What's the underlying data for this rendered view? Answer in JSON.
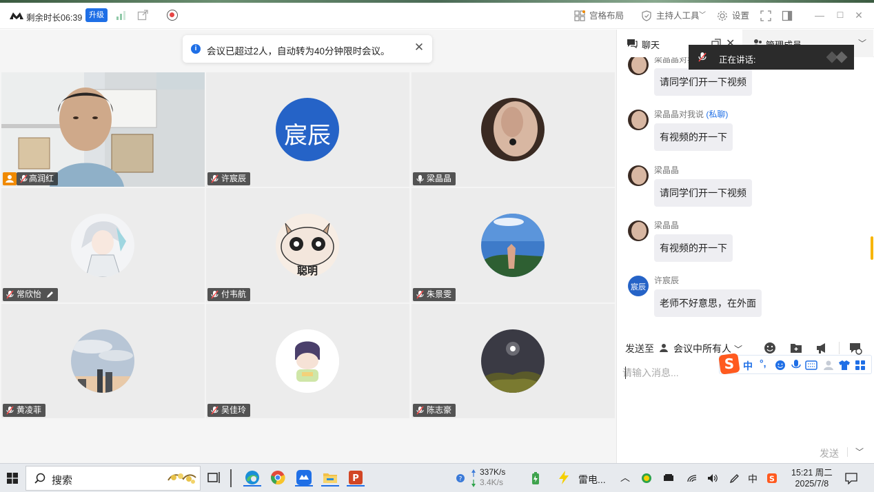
{
  "titlebar": {
    "time_remaining": "剩余时长06:39",
    "upgrade_label": "升级",
    "layout_label": "宫格布局",
    "host_tools_label": "主持人工具",
    "settings_label": "设置"
  },
  "notice": {
    "message": "会议已超过2人，自动转为40分钟限时会议。"
  },
  "participants": [
    {
      "name": "高润红",
      "host": true
    },
    {
      "name": "许宸辰",
      "avatar_text": "宸辰"
    },
    {
      "name": "梁晶晶"
    },
    {
      "name": "常欣怡"
    },
    {
      "name": "付韦航",
      "avatar_text": "聪明"
    },
    {
      "name": "朱景雯"
    },
    {
      "name": "黄凌菲"
    },
    {
      "name": "吴佳玲"
    },
    {
      "name": "陈志豪"
    }
  ],
  "panel": {
    "tab_chat": "聊天",
    "tab_members": "管理成员",
    "speaking_label": "正在讲话:",
    "messages": [
      {
        "sender": "梁晶晶对我说",
        "private": "",
        "text": "请同学们开一下视频"
      },
      {
        "sender": "梁晶晶对我说",
        "private": "(私聊)",
        "text": "有视频的开一下"
      },
      {
        "sender": "梁晶晶",
        "private": "",
        "text": "请同学们开一下视频"
      },
      {
        "sender": "梁晶晶",
        "private": "",
        "text": "有视频的开一下"
      },
      {
        "sender": "许宸辰",
        "private": "",
        "text": "老师不好意思，在外面",
        "avatar_text": "宸辰"
      }
    ],
    "send_to_label": "发送至",
    "recipient": "会议中所有人",
    "input_placeholder": "请输入消息...",
    "send_label": "发送"
  },
  "taskbar": {
    "search_label": "搜索",
    "net_up": "337K/s",
    "net_down": "3.4K/s",
    "thunder_label": "雷电...",
    "time": "15:21 周二",
    "date": "2025/7/8",
    "ime_label": "中"
  },
  "colors": {
    "accent": "#1f6fe6",
    "host": "#f08a00",
    "bubble": "#eeeef2"
  }
}
